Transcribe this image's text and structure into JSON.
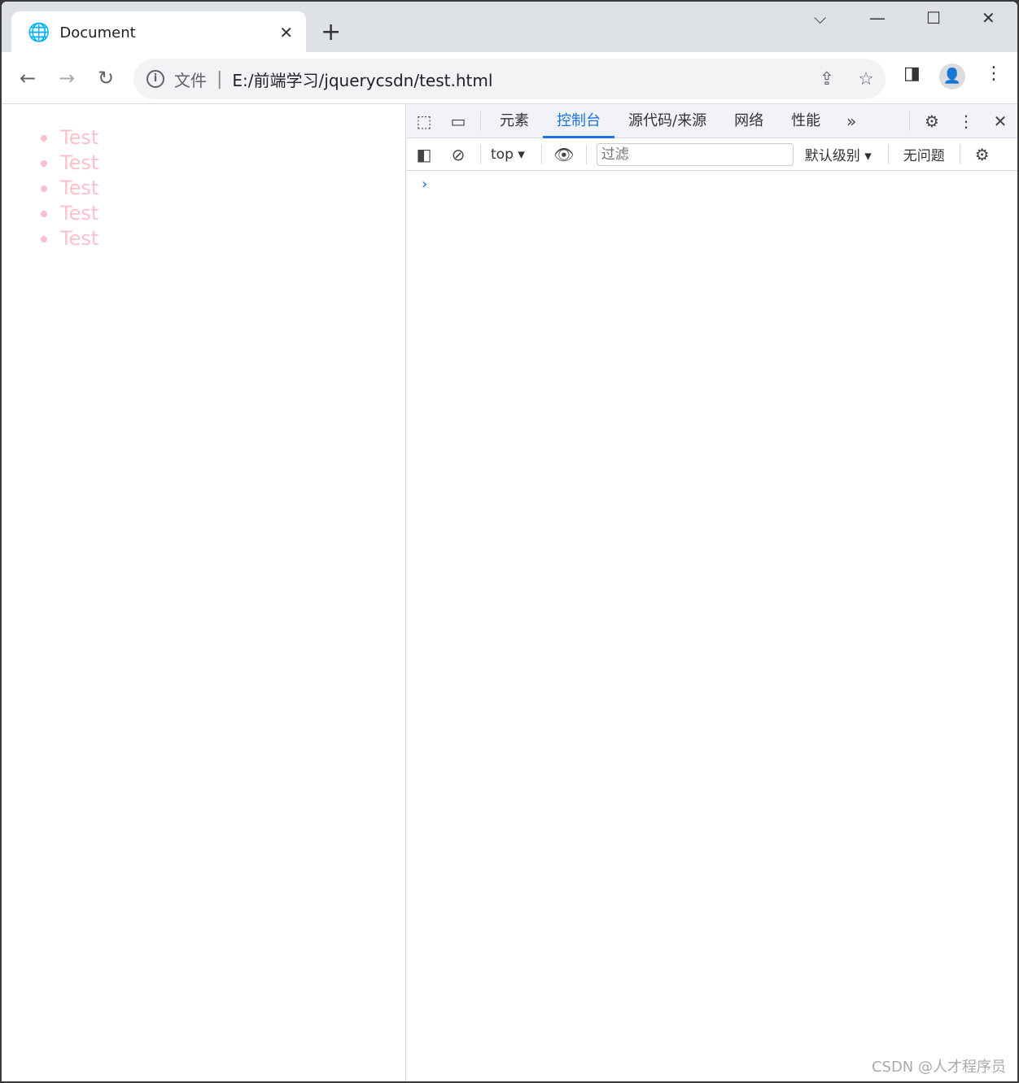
{
  "tab": {
    "title": "Document"
  },
  "address": {
    "prefix": "文件",
    "url": "E:/前端学习/jquerycsdn/test.html"
  },
  "page": {
    "items": [
      "Test",
      "Test",
      "Test",
      "Test",
      "Test"
    ],
    "color": "#ffc0cb"
  },
  "devtools": {
    "tabs": [
      "元素",
      "控制台",
      "源代码/来源",
      "网络",
      "性能"
    ],
    "active_tab": "控制台",
    "context": "top",
    "filter_placeholder": "过滤",
    "level": "默认级别",
    "issues": "无问题"
  },
  "watermark": "CSDN @人才程序员"
}
